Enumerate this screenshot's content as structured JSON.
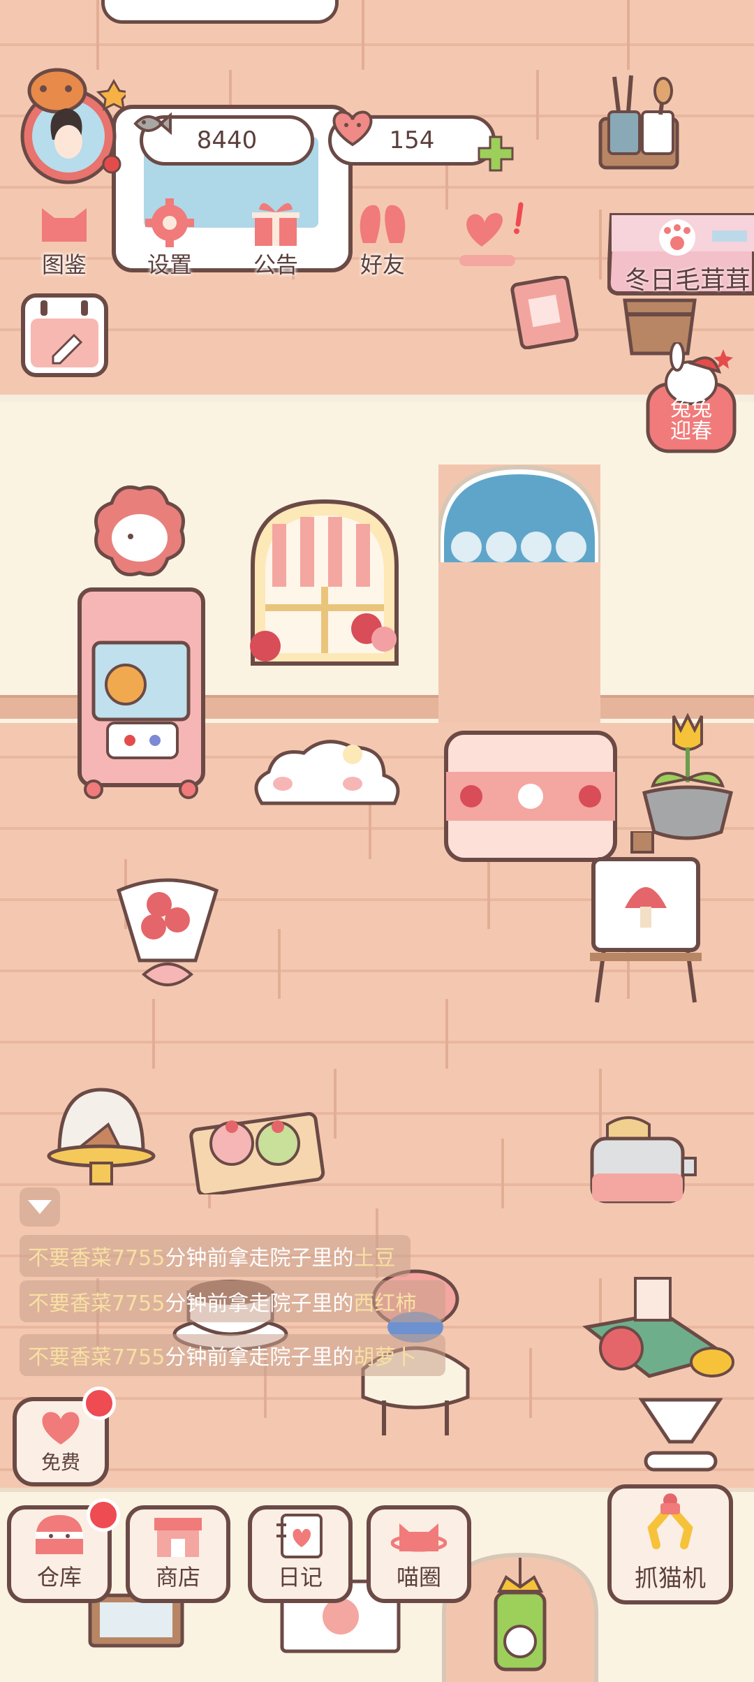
{
  "counters": {
    "fish_value": "8440",
    "heart_value": "154"
  },
  "menu": {
    "items": [
      {
        "label": "图鉴",
        "icon": "cat-head-icon"
      },
      {
        "label": "设置",
        "icon": "gear-icon"
      },
      {
        "label": "公告",
        "icon": "gift-icon"
      },
      {
        "label": "好友",
        "icon": "friends-icon"
      }
    ]
  },
  "event_banner": {
    "label": "冬日毛茸茸"
  },
  "rabbit_event": {
    "label_line1": "兔兔",
    "label_line2": "迎春"
  },
  "activity_log": [
    {
      "user": "不要香菜7755",
      "text": "分钟前拿走院子里的",
      "item": "土豆"
    },
    {
      "user": "不要香菜7755",
      "text": "分钟前拿走院子里的",
      "item": "西红柿"
    },
    {
      "user": "不要香菜7755",
      "text": "分钟前拿走院子里的",
      "item": "胡萝卜"
    }
  ],
  "free_button": {
    "label": "免费"
  },
  "nav": {
    "warehouse": "仓库",
    "shop": "商店",
    "diary": "日记",
    "circle": "喵圈",
    "claw": "抓猫机"
  },
  "colors": {
    "floor": "#f3c7ae",
    "wall": "#fbf3e2",
    "outline": "#6b4a46",
    "accent_pink": "#f07b7a",
    "badge_red": "#ee4b53",
    "highlight_yellow": "#f8e0a2"
  }
}
